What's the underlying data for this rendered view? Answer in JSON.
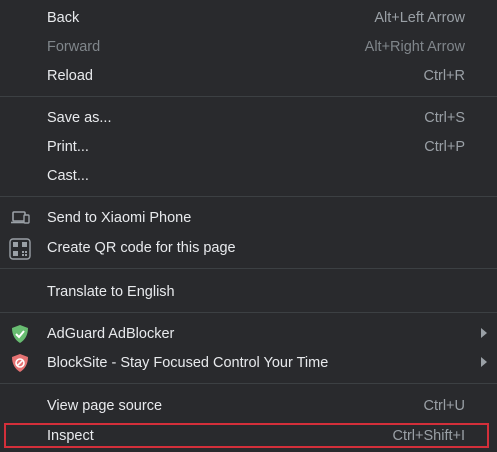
{
  "menu": {
    "back": {
      "label": "Back",
      "shortcut": "Alt+Left Arrow"
    },
    "forward": {
      "label": "Forward",
      "shortcut": "Alt+Right Arrow"
    },
    "reload": {
      "label": "Reload",
      "shortcut": "Ctrl+R"
    },
    "save_as": {
      "label": "Save as...",
      "shortcut": "Ctrl+S"
    },
    "print": {
      "label": "Print...",
      "shortcut": "Ctrl+P"
    },
    "cast": {
      "label": "Cast..."
    },
    "send_to_device": {
      "label": "Send to Xiaomi Phone",
      "icon": "device-send-icon"
    },
    "qr_code": {
      "label": "Create QR code for this page",
      "icon": "qr-code-icon"
    },
    "translate": {
      "label": "Translate to English"
    },
    "adguard": {
      "label": "AdGuard AdBlocker",
      "icon": "adguard-shield-icon",
      "color": "#68bc71"
    },
    "blocksite": {
      "label": "BlockSite - Stay Focused  Control Your Time",
      "icon": "blocksite-shield-icon",
      "color": "#e57373"
    },
    "view_source": {
      "label": "View page source",
      "shortcut": "Ctrl+U"
    },
    "inspect": {
      "label": "Inspect",
      "shortcut": "Ctrl+Shift+I",
      "highlight_color": "#d32f3a"
    }
  }
}
